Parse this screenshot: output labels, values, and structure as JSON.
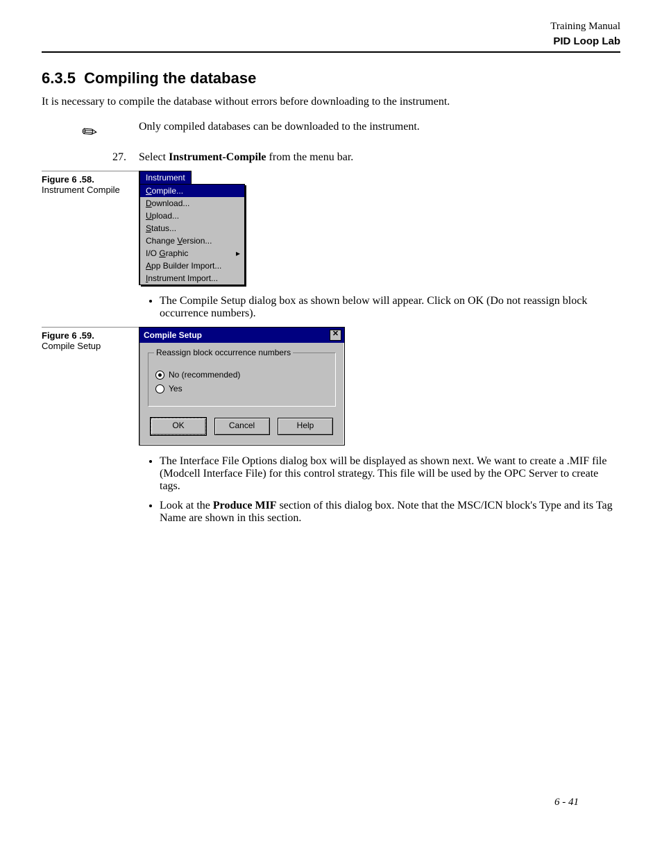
{
  "header": {
    "line1": "Training Manual",
    "line2": "PID Loop Lab"
  },
  "section": {
    "number": "6.3.5",
    "title": "Compiling the database"
  },
  "intro": "It is necessary to compile the database without errors before downloading to the instrument.",
  "note": "Only compiled databases can be downloaded to the instrument.",
  "step27": {
    "number": "27.",
    "prefix": "Select ",
    "bold": "Instrument-Compile",
    "suffix": " from the menu bar."
  },
  "figure58": {
    "num": "Figure 6 .58.",
    "caption": "Instrument Compile",
    "menuTitle": "Instrument",
    "items": {
      "compile": "Compile...",
      "download": "Download...",
      "upload": "Upload...",
      "status": "Status...",
      "changeVersion": "Change Version...",
      "ioGraphic": "I/O Graphic",
      "appBuilder": "App Builder Import...",
      "instrumentImport": "Instrument Import..."
    }
  },
  "bullet1": "The Compile Setup dialog box as shown below will appear. Click on OK (Do not reassign block occurrence numbers).",
  "figure59": {
    "num": "Figure 6 .59.",
    "caption": "Compile Setup",
    "dialogTitle": "Compile Setup",
    "groupLabel": "Reassign block occurrence numbers",
    "radioNo": "No (recommended)",
    "radioYes": "Yes",
    "btnOk": "OK",
    "btnCancel": "Cancel",
    "btnHelp": "Help"
  },
  "bullet2": "The Interface File Options dialog box will be displayed as shown next. We want to create a .MIF file (Modcell Interface File) for this control strategy. This file will be used by the OPC Server to create tags.",
  "bullet3": {
    "prefix": "Look at the ",
    "bold": "Produce MIF",
    "suffix": " section of this dialog box. Note that the MSC/ICN block's Type and its Tag Name are shown in this section."
  },
  "footer": "6 - 41"
}
